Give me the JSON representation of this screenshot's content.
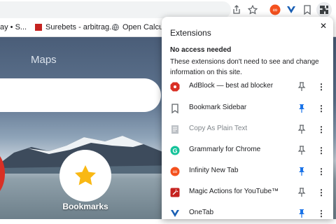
{
  "toolbar": {
    "share_icon": "share-icon",
    "star_icon": "star-icon",
    "extensions_icon": "puzzle-icon"
  },
  "bookmarks_bar": {
    "items": [
      {
        "label": "ay • S..."
      },
      {
        "label": "Surebets - arbitrag..."
      },
      {
        "label": "Open Calculat"
      }
    ]
  },
  "newtab": {
    "maps_label": "Maps",
    "bookmarks_tile_label": "Bookmarks"
  },
  "extensions_panel": {
    "title": "Extensions",
    "close_icon": "close-icon",
    "section_title": "No access needed",
    "section_description": "These extensions don't need to see and change information on this site.",
    "items": [
      {
        "name": "AdBlock — best ad blocker",
        "pinned": false,
        "icon": "adblock-icon"
      },
      {
        "name": "Bookmark Sidebar",
        "pinned": true,
        "icon": "bookmark-icon"
      },
      {
        "name": "Copy As Plain Text",
        "pinned": false,
        "icon": "document-icon"
      },
      {
        "name": "Grammarly for Chrome",
        "pinned": false,
        "icon": "grammarly-icon"
      },
      {
        "name": "Infinity New Tab",
        "pinned": true,
        "icon": "infinity-icon"
      },
      {
        "name": "Magic Actions for YouTube™",
        "pinned": false,
        "icon": "magic-actions-icon"
      },
      {
        "name": "OneTab",
        "pinned": true,
        "icon": "onetab-icon"
      }
    ]
  },
  "colors": {
    "pin_active": "#1a73e8",
    "pin_inactive": "#5f6368",
    "adblock_red": "#d93025",
    "grammarly_green": "#15c39a",
    "infinity_orange": "#f4511e",
    "onetab_blue": "#1a5fb4"
  }
}
